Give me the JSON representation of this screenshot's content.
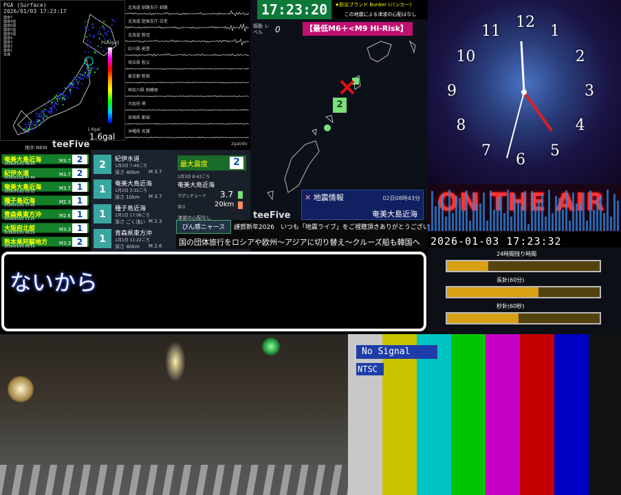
{
  "pga": {
    "title": "PGA (Surface)",
    "datetime": "2026/01/03 17:23:17",
    "legend_items": [
      "震度7",
      "震度6強",
      "震度6弱",
      "震度5強",
      "震度5弱",
      "震度4",
      "震度3",
      "震度2",
      "震度1",
      "未満"
    ],
    "legend_unit": "PGA[gal]",
    "scale_label": "1.6gal",
    "gal_value": "1.6gal",
    "corner_text": "地中 NEW"
  },
  "waveform": {
    "stations": [
      "北海道 釧路支庁 釧路",
      "北海道 胆振支庁 白老",
      "北海道 新冠",
      "石川県 能登",
      "埼玉県 秩父",
      "東京都 新宿",
      "神奈川県 相模原",
      "大阪府 堺",
      "宮崎県 都城",
      "沖縄県 名護"
    ],
    "unit": "2gal/div"
  },
  "logo": "teeFive",
  "eq_list": [
    {
      "name": "奄美大島近海",
      "time": "2026/01/03 06:43",
      "mag": "M3.7",
      "scale": "2"
    },
    {
      "name": "紀伊水道",
      "time": "2026/01/02 07:49",
      "mag": "M3.7",
      "scale": "2"
    },
    {
      "name": "奄美大島近海",
      "time": "2026/01/02 03:32",
      "mag": "M3.7",
      "scale": "1"
    },
    {
      "name": "種子島近海",
      "time": "2026/01/01 17:06",
      "mag": "M2.3",
      "scale": "1"
    },
    {
      "name": "青森県東方沖",
      "time": "2026/01/01 11:22",
      "mag": "M2.6",
      "scale": "1"
    },
    {
      "name": "大阪府北部",
      "time": "2026/01/01 06:29",
      "mag": "M3.3",
      "scale": "1"
    },
    {
      "name": "熊本県阿蘇地方",
      "time": "2026/01/01 05:51",
      "mag": "M3.3",
      "scale": "2"
    }
  ],
  "quake_cards": [
    {
      "scale": "2",
      "place": "紀伊水道",
      "time": "1月2日 7:49ごろ",
      "depth": "深さ 40km",
      "mag": "M 3.7"
    },
    {
      "scale": "1",
      "place": "奄美大島近海",
      "time": "1月2日 3:32ごろ",
      "depth": "深さ 10km",
      "mag": "M 3.7"
    },
    {
      "scale": "1",
      "place": "種子島近海",
      "time": "1月1日 17:06ごろ",
      "depth": "深さ ごく浅い",
      "mag": "M 2.3"
    },
    {
      "scale": "1",
      "place": "青森県東方沖",
      "time": "1月1日 11:22ごろ",
      "depth": "深さ 40km",
      "mag": "M 2.6"
    }
  ],
  "max_intensity": {
    "label": "最大震度",
    "value": "2",
    "time": "1月3日 8:43ごろ",
    "place": "奄美大島近海",
    "magnitude_label": "マグニチュード",
    "magnitude": "3.7",
    "depth_label": "深さ",
    "depth": "20km"
  },
  "tsunami_note": "津波の心配なし",
  "clock_top": "17:23:20",
  "bunker": {
    "title": "★防災ブランド Bunker (バンカー)",
    "note": "この地震による津波の心配はなし"
  },
  "shindo_level": {
    "label": "振動 レベル",
    "value": "0"
  },
  "risk_banner": "【最低M6＋<M9 Hi-Risk】",
  "region_map": {
    "epicenter_scale": "2"
  },
  "info": {
    "title": "地震情報",
    "time": "02日08時43分",
    "place": "奄美大島近海"
  },
  "news": {
    "tag": "ぴん感ニャース",
    "line1": "謹賀新年2026　いつも「地震ライブ」をご視聴頂きありがとうございます!",
    "line2": "国の団体旅行をロシアや欧州〜アジアに切り替え〜クルーズ船も韓国ヘ"
  },
  "subtitle": "ないから",
  "analog_clock": {
    "numbers": [
      "12",
      "1",
      "2",
      "3",
      "4",
      "5",
      "6",
      "7",
      "8",
      "9",
      "10",
      "11"
    ]
  },
  "on_air": "ON THE AIR",
  "datetime": "2026-01-03 17:23:32",
  "progress_bars": [
    {
      "label": "24時間残り時間",
      "value": 0.27
    },
    {
      "label": "長針(60分)",
      "value": 0.6
    },
    {
      "label": "秒針(60秒)",
      "value": 0.47
    }
  ],
  "test_signal": {
    "no_signal": "No Signal",
    "ntsc": "NTSC"
  },
  "colors": {
    "accent_green": "#0d7a3a",
    "risk_pink": "#c01070",
    "onair_red": "#ff3535",
    "bar_gold": "#d8a015",
    "bar_colors": [
      "#c8c8c8",
      "#c8c400",
      "#00c4c4",
      "#00c400",
      "#c400c4",
      "#c40000",
      "#0000c4",
      "#111111"
    ]
  }
}
